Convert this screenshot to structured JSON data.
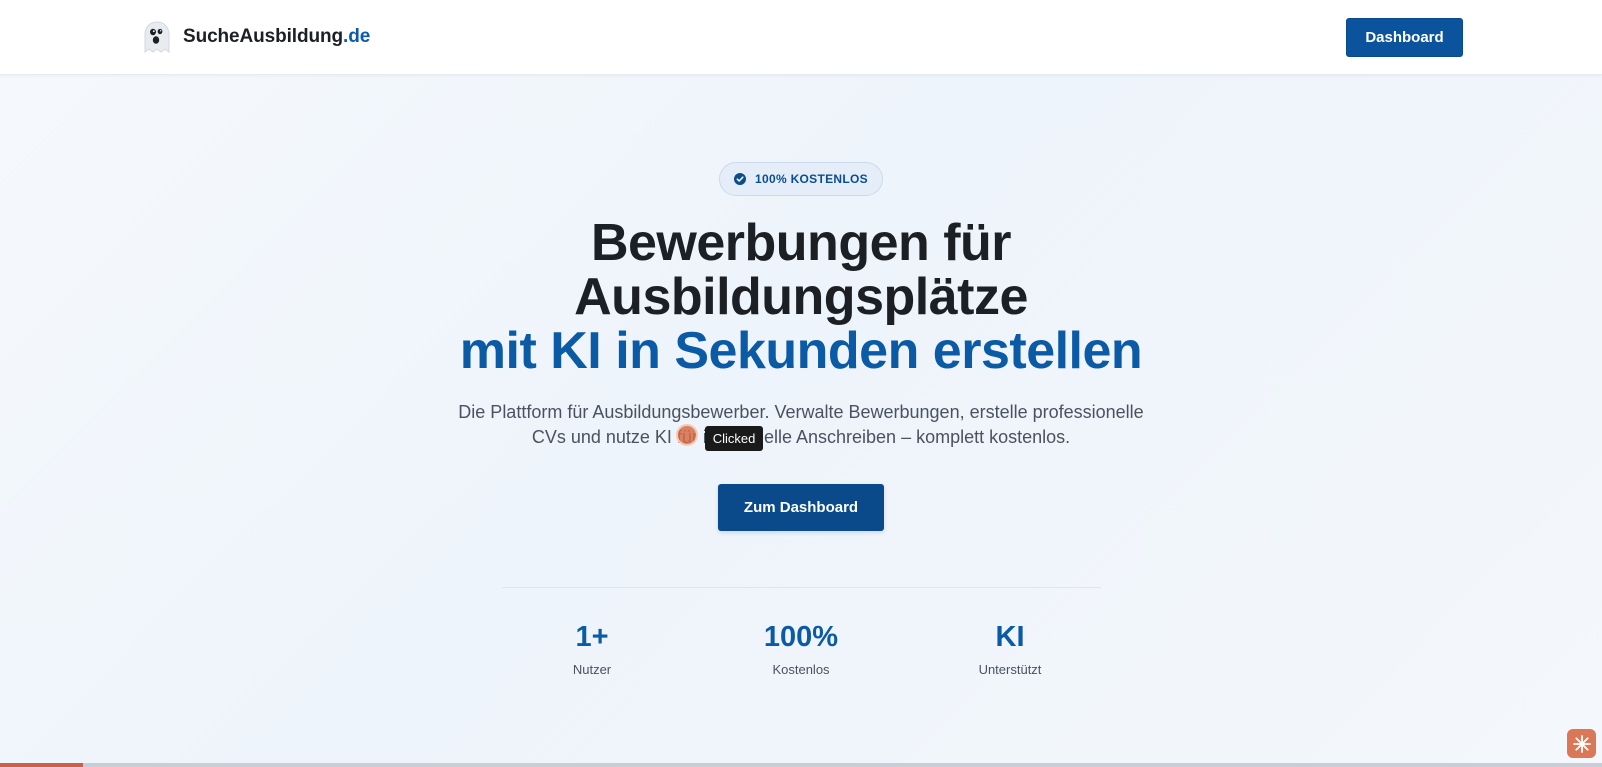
{
  "header": {
    "brand_name": "SucheAusbildung",
    "brand_tld": ".de",
    "dashboard_label": "Dashboard"
  },
  "hero": {
    "badge_text": "100% KOSTENLOS",
    "headline_line1": "Bewerbungen für",
    "headline_line2": "Ausbildungsplätze",
    "headline_line3": "mit KI in Sekunden erstellen",
    "lead_line1": "Die Plattform für Ausbildungsbewerber. Verwalte Bewerbungen, erstelle professionelle",
    "lead_line2": "CVs und nutze KI für individuelle Anschreiben – komplett kostenlos.",
    "cta_label": "Zum Dashboard"
  },
  "overlay": {
    "tooltip_text": "Clicked"
  },
  "stats": [
    {
      "value": "1+",
      "label": "Nutzer"
    },
    {
      "value": "100%",
      "label": "Kostenlos"
    },
    {
      "value": "KI",
      "label": "Unterstützt"
    }
  ],
  "progress": {
    "percent": 5.2
  },
  "colors": {
    "brand_blue": "#0b5aa6",
    "button_blue": "#0b539c",
    "text_dark": "#1c1f24",
    "assistant_accent": "#d97757"
  }
}
